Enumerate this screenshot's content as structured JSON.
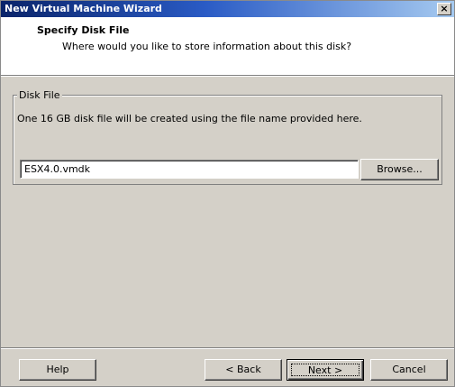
{
  "window": {
    "title": "New Virtual Machine Wizard",
    "close_label": "×"
  },
  "header": {
    "title": "Specify Disk File",
    "subtitle": "Where would you like to store information about this disk?"
  },
  "disk_file_group": {
    "legend": "Disk File",
    "description": "One 16 GB disk file will be created using the file name provided here.",
    "file_name_value": "ESX4.0.vmdk",
    "browse_label": "Browse..."
  },
  "footer": {
    "help_label": "Help",
    "back_label": "< Back",
    "next_label": "Next >",
    "cancel_label": "Cancel"
  }
}
